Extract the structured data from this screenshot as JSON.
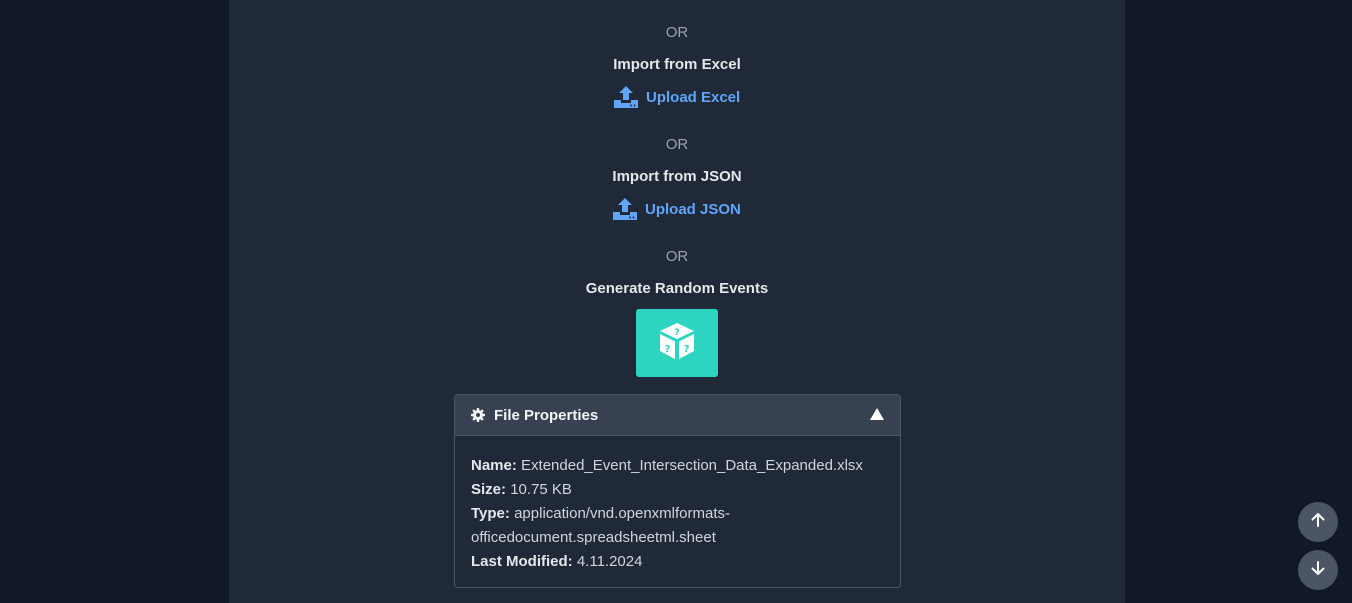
{
  "sections": {
    "or_1": "OR",
    "excel_heading": "Import from Excel",
    "excel_upload_label": "Upload Excel",
    "or_2": "OR",
    "json_heading": "Import from JSON",
    "json_upload_label": "Upload JSON",
    "or_3": "OR",
    "random_heading": "Generate Random Events"
  },
  "file_properties": {
    "title": "File Properties",
    "name_label": "Name:",
    "name_value": "Extended_Event_Intersection_Data_Expanded.xlsx",
    "size_label": "Size:",
    "size_value": "10.75 KB",
    "type_label": "Type:",
    "type_value_line1": "application/vnd.openxmlformats-",
    "type_value_line2": "officedocument.spreadsheetml.sheet",
    "modified_label": "Last Modified:",
    "modified_value": "4.11.2024"
  },
  "colors": {
    "page_bg": "#111827",
    "panel_bg": "#1f2937",
    "link": "#60a5fa",
    "dice_button": "#2dd4bf"
  },
  "icons": {
    "upload": "upload-icon",
    "dice": "dice-icon",
    "gear": "gear-icon",
    "collapse": "triangle-up-icon",
    "scroll_up": "arrow-up-icon",
    "scroll_down": "arrow-down-icon"
  }
}
